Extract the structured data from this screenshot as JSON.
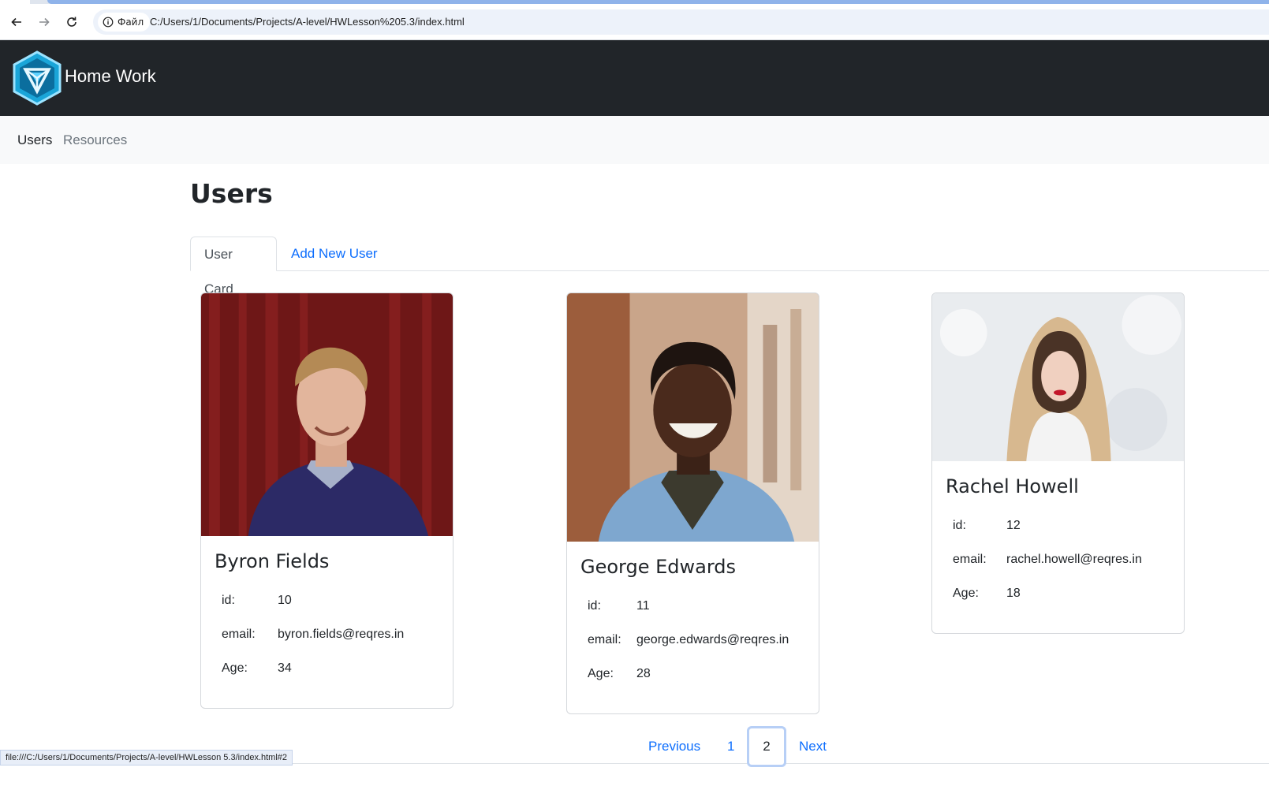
{
  "browser": {
    "site_chip_label": "Файл",
    "url": "C:/Users/1/Documents/Projects/A-level/HWLesson%205.3/index.html",
    "status_url": "file:///C:/Users/1/Documents/Projects/A-level/HWLesson 5.3/index.html#2"
  },
  "navbar": {
    "brand": "Home Work",
    "links": [
      "Users",
      "Resources"
    ]
  },
  "page": {
    "title": "Users",
    "tabs": [
      "User Card",
      "Add New User"
    ]
  },
  "labels": {
    "id": "id:",
    "email": "email:",
    "age": "Age:"
  },
  "users": [
    {
      "name": "Byron Fields",
      "id": "10",
      "email": "byron.fields@reqres.in",
      "age": "34"
    },
    {
      "name": "George Edwards",
      "id": "11",
      "email": "george.edwards@reqres.in",
      "age": "28"
    },
    {
      "name": "Rachel Howell",
      "id": "12",
      "email": "rachel.howell@reqres.in",
      "age": "18"
    }
  ],
  "pagination": {
    "previous": "Previous",
    "pages": [
      "1",
      "2"
    ],
    "current": "2",
    "next": "Next"
  },
  "colors": {
    "navbar_bg": "#212529",
    "subnav_bg": "#f8f9fa",
    "link": "#0d6efd"
  }
}
